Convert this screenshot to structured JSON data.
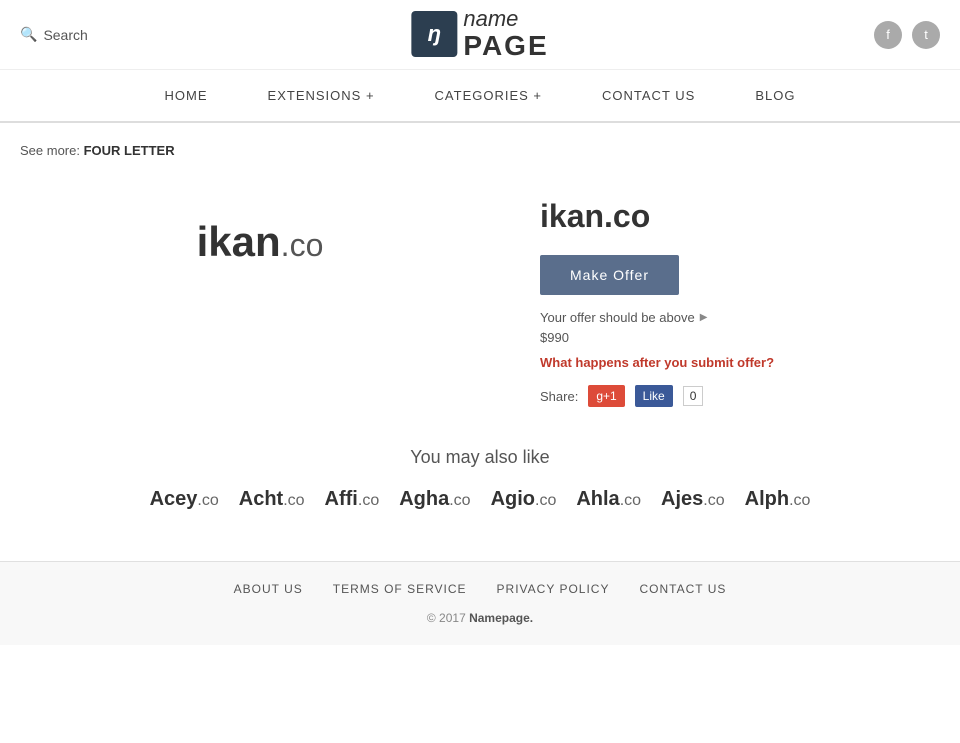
{
  "header": {
    "search_label": "Search",
    "logo_icon": "ŋ",
    "logo_name": "name",
    "logo_page": "PAGE",
    "social": [
      {
        "name": "facebook",
        "icon": "f"
      },
      {
        "name": "twitter",
        "icon": "t"
      }
    ]
  },
  "nav": {
    "items": [
      {
        "label": "HOME",
        "href": "#"
      },
      {
        "label": "EXTENSIONS +",
        "href": "#"
      },
      {
        "label": "CATEGORIES +",
        "href": "#"
      },
      {
        "label": "CONTACT US",
        "href": "#"
      },
      {
        "label": "BLOG",
        "href": "#"
      }
    ]
  },
  "breadcrumb": {
    "prefix": "See more:",
    "label": "FOUR LETTER"
  },
  "domain": {
    "name": "ikan",
    "ext": ".co",
    "full": "ikan.co",
    "make_offer_label": "Make Offer",
    "offer_hint": "Your offer should be above",
    "offer_price": "$990",
    "offer_link_text": "What happens after you submit offer?",
    "share_label": "Share:",
    "gplus_label": "g+1",
    "fb_like_label": "Like",
    "fb_count": "0"
  },
  "also_like": {
    "heading": "You may also like",
    "domains": [
      {
        "name": "Acey",
        "ext": ".co"
      },
      {
        "name": "Acht",
        "ext": ".co"
      },
      {
        "name": "Affi",
        "ext": ".co"
      },
      {
        "name": "Agha",
        "ext": ".co"
      },
      {
        "name": "Agio",
        "ext": ".co"
      },
      {
        "name": "Ahla",
        "ext": ".co"
      },
      {
        "name": "Ajes",
        "ext": ".co"
      },
      {
        "name": "Alph",
        "ext": ".co"
      }
    ]
  },
  "footer": {
    "links": [
      {
        "label": "ABOUT US",
        "href": "#"
      },
      {
        "label": "TERMS OF SERVICE",
        "href": "#"
      },
      {
        "label": "PRIVACY POLICY",
        "href": "#"
      },
      {
        "label": "CONTACT US",
        "href": "#"
      }
    ],
    "copy": "© 2017",
    "brand": "Namepage."
  }
}
